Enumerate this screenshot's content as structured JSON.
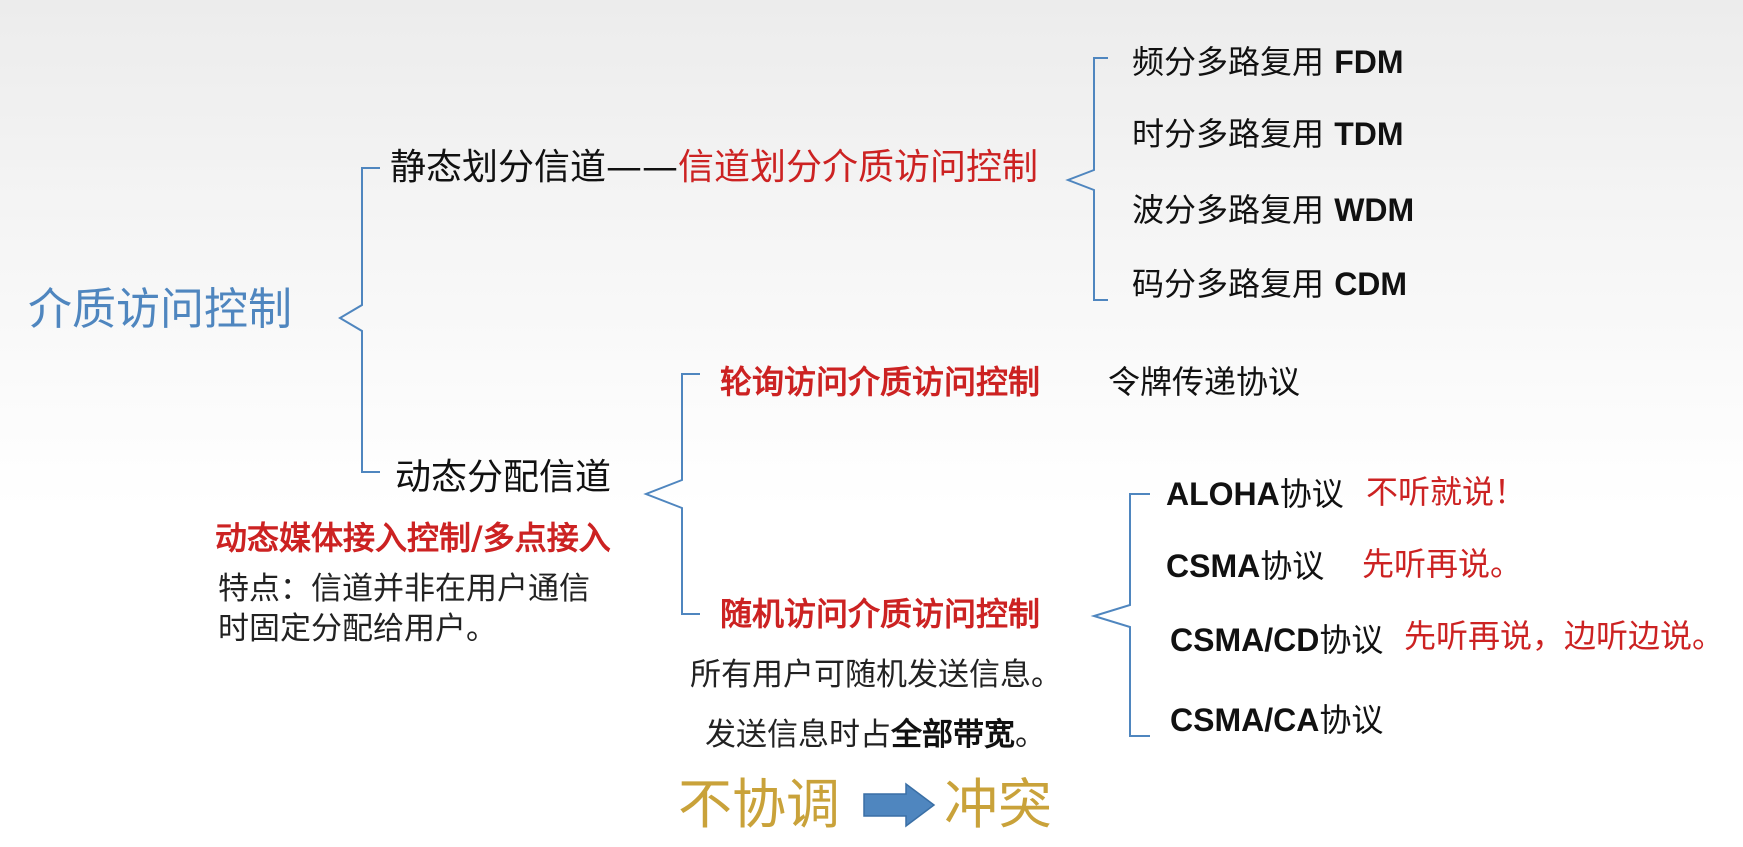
{
  "root": "介质访问控制",
  "static": {
    "prefix": "静态划分信道——",
    "method": "信道划分介质访问控制",
    "items": [
      {
        "zh": "频分多路复用 ",
        "en": "FDM"
      },
      {
        "zh": "时分多路复用 ",
        "en": "TDM"
      },
      {
        "zh": "波分多路复用 ",
        "en": "WDM"
      },
      {
        "zh": "码分多路复用 ",
        "en": "CDM"
      }
    ]
  },
  "dynamic": {
    "label": "动态分配信道",
    "subtitle": "动态媒体接入控制/多点接入",
    "feature_line1": "特点：信道并非在用户通信",
    "feature_line2": "时固定分配给用户。",
    "polling": {
      "label": "轮询访问介质访问控制",
      "protocol": "令牌传递协议"
    },
    "random": {
      "label": "随机访问介质访问控制",
      "desc_line1": "所有用户可随机发送信息。",
      "desc_line2_pre": "发送信息时占",
      "desc_line2_bold": "全部带宽",
      "desc_line2_post": "。",
      "protocols": [
        {
          "name": "ALOHA",
          "suffix": "协议",
          "note": "不听就说！"
        },
        {
          "name": "CSMA",
          "suffix": "协议",
          "note": "先听再说。"
        },
        {
          "name": "CSMA/CD",
          "suffix": "协议",
          "note": "先听再说，边听边说。"
        },
        {
          "name": "CSMA/CA",
          "suffix": "协议",
          "note": ""
        }
      ]
    }
  },
  "conclusion": {
    "from": "不协调",
    "to": "冲突"
  },
  "colors": {
    "root": "#4f86bf",
    "accent_red": "#cc2222",
    "gold": "#c9a23a",
    "arrow": "#4f86bf",
    "brace": "#4f86bf"
  }
}
